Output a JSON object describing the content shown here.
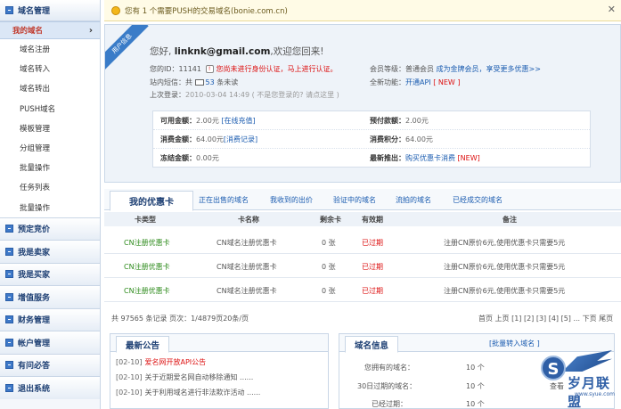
{
  "sidebar": {
    "header": "域名管理",
    "sub_items": [
      "我的域名",
      "域名注册",
      "域名转入",
      "域名转出",
      "PUSH域名",
      "模板管理",
      "分组管理",
      "批量操作",
      "任务列表",
      "批量操作"
    ],
    "active_chevron": "›",
    "groups": [
      "预定竞价",
      "我是卖家",
      "我是买家",
      "增值服务",
      "财务管理",
      "帐户管理",
      "有问必答",
      "退出系统"
    ]
  },
  "notice": {
    "text": "您有  1 个需要PUSH的交易域名(bonie.com.cn)",
    "close": "✕"
  },
  "welcome": {
    "ribbon": "用户信息",
    "greeting_prefix": "您好,",
    "email": "linknk@gmail.com",
    "greeting_suffix": ",欢迎您回来!",
    "user_id_label": "您的ID：",
    "user_id": "11141",
    "id_warning": "您尚未进行身份认证，",
    "id_warning_link": "马上进行认证。",
    "level_label": "会员等级：",
    "level_value": "普通会员",
    "level_link": "成为金牌会员，享受更多优惠>>",
    "msg_label": "站内短信：共",
    "msg_count": "53",
    "msg_suffix": "条未读",
    "feature_label": "全新功能：",
    "feature_link": "开通API",
    "feature_badge": "[ NEW ]",
    "last_login_label": "上次登录：",
    "last_login_time": "2010-03-04 14:49",
    "last_login_note": "( 不是您登录的? 请点这里 )",
    "balance": {
      "avail_label": "可用金额：",
      "avail_value": "2.00元",
      "avail_link": "[在线充值]",
      "prepay_label": "预付款额：",
      "prepay_value": "2.00元",
      "spent_label": "消费金额：",
      "spent_value": "64.00元",
      "spent_link": "[消费记录]",
      "points_label": "消费积分：",
      "points_value": "64.00元",
      "frozen_label": "冻结金额：",
      "frozen_value": "0.00元",
      "latest_label": "最新推出：",
      "latest_link": "购买优惠卡消费",
      "latest_badge": "[NEW]"
    }
  },
  "cards": {
    "active_tab": "我的优惠卡",
    "tabs": [
      "正在出售的域名",
      "我收到的出价",
      "验证中的域名",
      "流拍的域名",
      "已经成交的域名"
    ],
    "columns": [
      "卡类型",
      "卡名称",
      "剩余卡",
      "有效期",
      "备注"
    ],
    "rows": [
      {
        "type": "CN注册优惠卡",
        "name": "CN域名注册优惠卡",
        "remain": "0 张",
        "expiry": "已过期",
        "note": "注册CN原价6元,使用优惠卡只需要5元"
      },
      {
        "type": "CN注册优惠卡",
        "name": "CN域名注册优惠卡",
        "remain": "0 张",
        "expiry": "已过期",
        "note": "注册CN原价6元,使用优惠卡只需要5元"
      },
      {
        "type": "CN注册优惠卡",
        "name": "CN域名注册优惠卡",
        "remain": "0 张",
        "expiry": "已过期",
        "note": "注册CN原价6元,使用优惠卡只需要5元"
      }
    ],
    "pager_info": "共  97565 条记录  页次：1/4879页20条/页",
    "pager_nav": "首页  上页  [1] [2] [3] [4] [5] ...  下页  尾页"
  },
  "news": {
    "title": "最新公告",
    "items": [
      {
        "date": "[02-10]",
        "text": "爱名网开放API公告"
      },
      {
        "date": "[02-10]",
        "text": "关于近期爱名网自动移除通知 ......"
      },
      {
        "date": "[02-10]",
        "text": "关于利用域名进行非法欺诈活动 ......"
      }
    ]
  },
  "domain_info": {
    "title": "域名信息",
    "batch_link": "[批量转入域名 ]",
    "more_link": "查看",
    "rows": [
      {
        "label": "您拥有的域名：",
        "value": "10 个"
      },
      {
        "label": "30日过期的域名：",
        "value": "10 个"
      },
      {
        "label": "已经过期：",
        "value": "10 个"
      }
    ]
  },
  "watermark": {
    "mark": "S",
    "name": "岁月联盟",
    "url": "www.syue.com"
  }
}
